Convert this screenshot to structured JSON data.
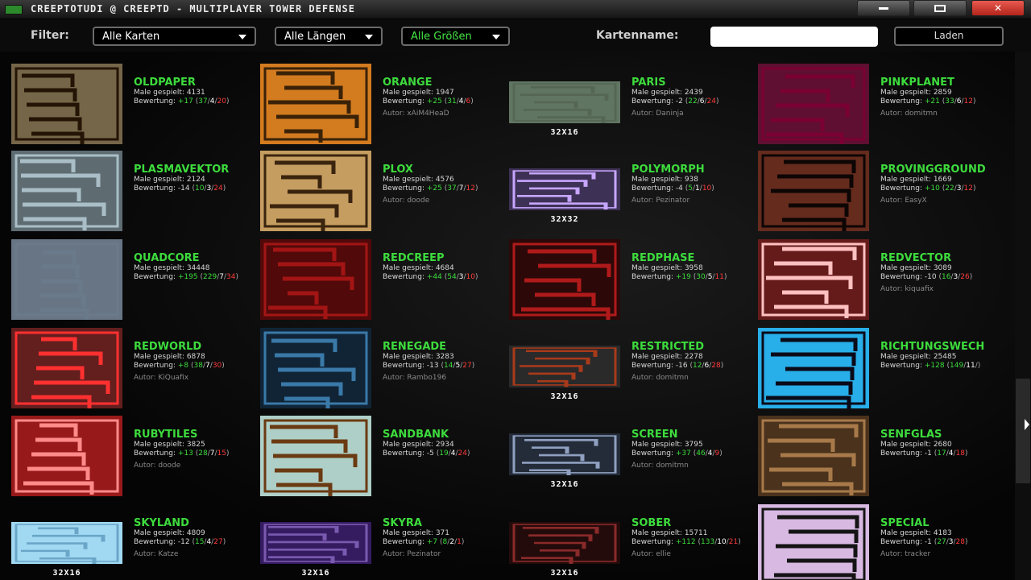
{
  "window": {
    "title": "CREEPTOTUDI @ CREEPTD - MULTIPLAYER TOWER DEFENSE"
  },
  "filter": {
    "label": "Filter:",
    "maps": "Alle Karten",
    "lengths": "Alle Längen",
    "sizes": "Alle Größen",
    "name_label": "Kartenname:",
    "name_value": "",
    "load": "Laden"
  },
  "texts": {
    "played": "Male gespielt:",
    "rating": "Bewertung:"
  },
  "maps": [
    {
      "name": "OLDPAPER",
      "played": "4131",
      "rating": "+17",
      "votes": [
        "37",
        "4",
        "20"
      ],
      "author": "",
      "size": "",
      "bg": "#3a2a16",
      "fg": "#e8d7a8",
      "line": "#241405"
    },
    {
      "name": "ORANGE",
      "played": "1947",
      "rating": "+25",
      "votes": [
        "31",
        "4",
        "6"
      ],
      "author": "Autor: xAiM4HeaD",
      "size": "",
      "bg": "#c86a12",
      "fg": "#e89a3a",
      "line": "#3a2208"
    },
    {
      "name": "PARIS",
      "played": "2439",
      "rating": "-2",
      "votes": [
        "22",
        "6",
        "24"
      ],
      "author": "Autor: Daninja",
      "size": "32X16",
      "bg": "#2f4a35",
      "fg": "#bcc7b7",
      "line": "#556655"
    },
    {
      "name": "PINKPLANET",
      "played": "2859",
      "rating": "+21",
      "votes": [
        "33",
        "6",
        "12"
      ],
      "author": "Autor: domitmn",
      "size": "",
      "bg": "#0a0a0a",
      "fg": "#ff1a7a",
      "line": "#7a0033"
    },
    {
      "name": "PLASMAVEKTOR",
      "played": "2124",
      "rating": "-14",
      "votes": [
        "10",
        "3",
        "24"
      ],
      "author": "",
      "size": "",
      "bg": "#1a2a30",
      "fg": "#dfe9ef",
      "line": "#a9bec7"
    },
    {
      "name": "PLOX",
      "played": "4576",
      "rating": "+25",
      "votes": [
        "37",
        "7",
        "12"
      ],
      "author": "Autor: doode",
      "size": "",
      "bg": "#b58a4a",
      "fg": "#e3c08a",
      "line": "#3a240e"
    },
    {
      "name": "POLYMORPH",
      "played": "938",
      "rating": "-4",
      "votes": [
        "5",
        "1",
        "10"
      ],
      "author": "Autor: Pezinator",
      "size": "32X32",
      "bg": "#0a0a12",
      "fg": "#a17ad8",
      "line": "#c7a6ff"
    },
    {
      "name": "PROVINGGROUND",
      "played": "1669",
      "rating": "+10",
      "votes": [
        "22",
        "3",
        "12"
      ],
      "author": "Autor: EasyX",
      "size": "",
      "bg": "#5a2418",
      "fg": "#7a3a28",
      "line": "#0d0605"
    },
    {
      "name": "QUADCORE",
      "played": "34448",
      "rating": "+195",
      "votes": [
        "229",
        "7",
        "34"
      ],
      "author": "",
      "size": "",
      "bg": "#2c3a4a",
      "fg": "#d9e4f0",
      "line": "#6a7a8a"
    },
    {
      "name": "REDCREEP",
      "played": "4684",
      "rating": "+44",
      "votes": [
        "54",
        "3",
        "10"
      ],
      "author": "",
      "size": "",
      "bg": "#3d0606",
      "fg": "#7a1010",
      "line": "#a31515"
    },
    {
      "name": "REDPHASE",
      "played": "3958",
      "rating": "+19",
      "votes": [
        "30",
        "5",
        "11"
      ],
      "author": "",
      "size": "",
      "bg": "#140505",
      "fg": "#5a0d0d",
      "line": "#b01a1a"
    },
    {
      "name": "REDVECTOR",
      "played": "3089",
      "rating": "-10",
      "votes": [
        "16",
        "3",
        "26"
      ],
      "author": "Autor: kiquafix",
      "size": "",
      "bg": "#4a1010",
      "fg": "#9a3030",
      "line": "#ffc0c0"
    },
    {
      "name": "REDWORLD",
      "played": "6878",
      "rating": "+8",
      "votes": [
        "38",
        "7",
        "30"
      ],
      "author": "Autor: KiQuafix",
      "size": "",
      "bg": "#100404",
      "fg": "#ff5050",
      "line": "#ff3030"
    },
    {
      "name": "RENEGADE",
      "played": "3283",
      "rating": "-13",
      "votes": [
        "14",
        "5",
        "27"
      ],
      "author": "Autor: Rambo196",
      "size": "",
      "bg": "#0c1a26",
      "fg": "#1a3a55",
      "line": "#3a79a8"
    },
    {
      "name": "RESTRICTED",
      "played": "2278",
      "rating": "-16",
      "votes": [
        "12",
        "6",
        "28"
      ],
      "author": "Autor: domitmn",
      "size": "32X16",
      "bg": "#222222",
      "fg": "#3a3a3a",
      "line": "#a83a1a"
    },
    {
      "name": "RICHTUNGSWECH",
      "played": "25485",
      "rating": "+128",
      "votes": [
        "149",
        "11",
        ""
      ],
      "author": "",
      "size": "",
      "bg": "#1ea5e0",
      "fg": "#3bc1f5",
      "line": "#0a0a18"
    },
    {
      "name": "RUBYTILES",
      "played": "3825",
      "rating": "+13",
      "votes": [
        "28",
        "7",
        "15"
      ],
      "author": "Autor: doode",
      "size": "",
      "bg": "#8a1010",
      "fg": "#b02a2a",
      "line": "#ff8a8a"
    },
    {
      "name": "SANDBANK",
      "played": "2934",
      "rating": "-5",
      "votes": [
        "19",
        "4",
        "24"
      ],
      "author": "",
      "size": "",
      "bg": "#8fd3e8",
      "fg": "#e8c88a",
      "line": "#6a3a12"
    },
    {
      "name": "SCREEN",
      "played": "3795",
      "rating": "+37",
      "votes": [
        "46",
        "4",
        "9"
      ],
      "author": "Autor: domitmn",
      "size": "32X16",
      "bg": "#1a1e28",
      "fg": "#3a4458",
      "line": "#8fa0c0"
    },
    {
      "name": "SENFGLAS",
      "played": "2680",
      "rating": "-1",
      "votes": [
        "17",
        "4",
        "18"
      ],
      "author": "",
      "size": "",
      "bg": "#3a2614",
      "fg": "#6a4a2a",
      "line": "#a87a4a"
    },
    {
      "name": "SKYLAND",
      "played": "4809",
      "rating": "-12",
      "votes": [
        "15",
        "4",
        "27"
      ],
      "author": "Autor: Katze",
      "size": "32X16",
      "bg": "#8ed0ee",
      "fg": "#c9ecfa",
      "line": "#6aa6c8"
    },
    {
      "name": "SKYRA",
      "played": "371",
      "rating": "+7",
      "votes": [
        "8",
        "2",
        "1"
      ],
      "author": "Autor: Pezinator",
      "size": "32X16",
      "bg": "#2a1450",
      "fg": "#4a2a80",
      "line": "#7a5ab0"
    },
    {
      "name": "SOBER",
      "played": "15711",
      "rating": "+112",
      "votes": [
        "133",
        "10",
        "21"
      ],
      "author": "Autor: ellie",
      "size": "32X16",
      "bg": "#1a0808",
      "fg": "#3a1010",
      "line": "#8a2a2a"
    },
    {
      "name": "SPECIAL",
      "played": "4183",
      "rating": "-1",
      "votes": [
        "27",
        "3",
        "28"
      ],
      "author": "Autor: tracker",
      "size": "",
      "bg": "#e8d0f0",
      "fg": "#b890c8",
      "line": "#141414"
    }
  ]
}
